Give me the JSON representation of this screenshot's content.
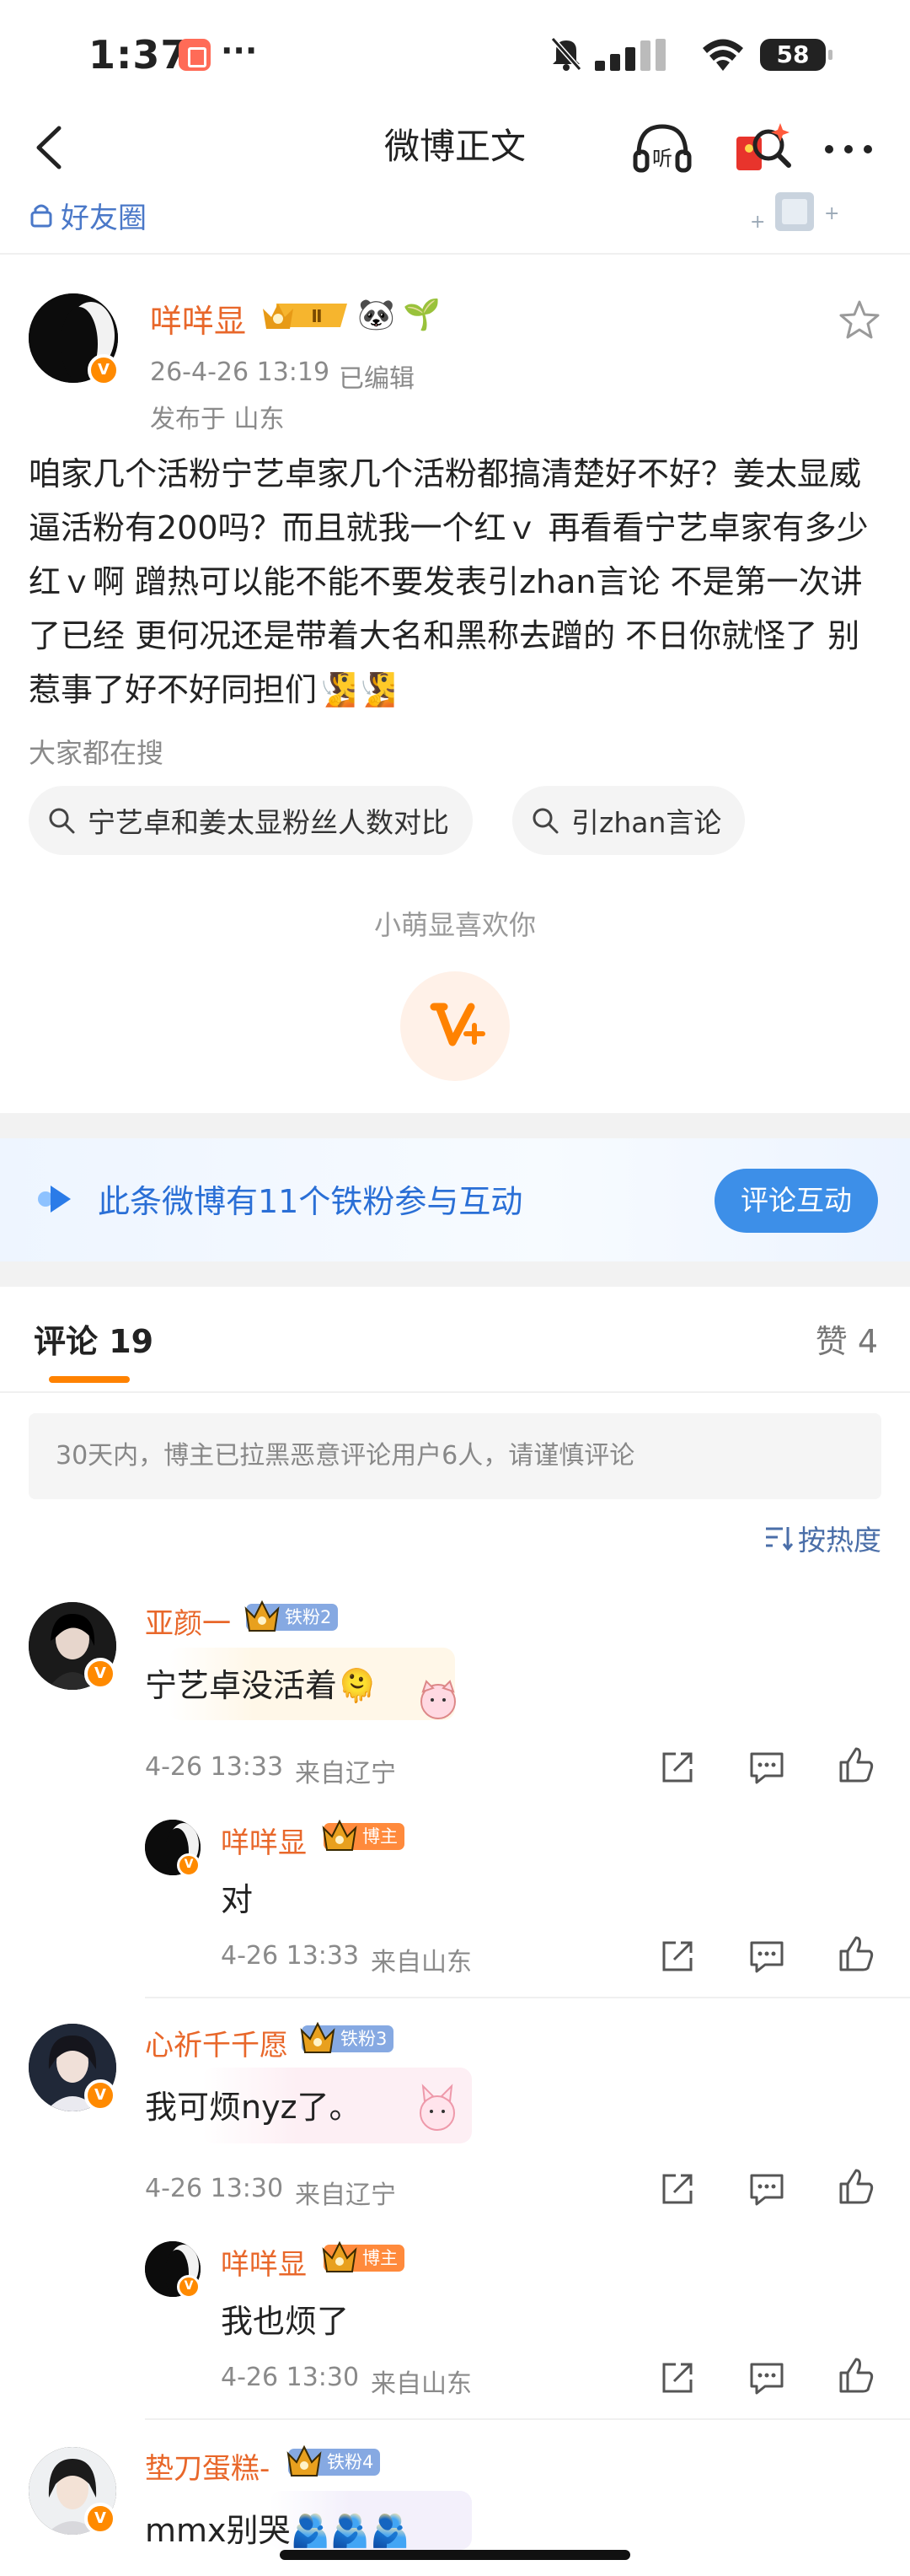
{
  "status_bar": {
    "time": "1:37",
    "dots": "···",
    "battery": "58"
  },
  "nav": {
    "title": "微博正文",
    "listen_label": "听"
  },
  "friends_label": "好友圈",
  "post": {
    "author": "咩咩显",
    "level_badge": "Ⅱ",
    "emoji": [
      "🐼",
      "🌱"
    ],
    "time": "26-4-26 13:19",
    "edited": "已编辑",
    "location": "发布于 山东",
    "text": "咱家几个活粉宁艺卓家几个活粉都搞清楚好不好？姜太显威逼活粉有200吗？而且就我一个红ｖ 再看看宁艺卓家有多少红ｖ啊 蹭热可以能不能不要发表引zhan言论 不是第一次讲了已经 更何况还是带着大名和黑称去蹭的 不日你就怪了 别惹事了好不好同担们🧏🧏",
    "search_label": "大家都在搜",
    "searches": [
      "宁艺卓和姜太显粉丝人数对比",
      "引zhan言论"
    ],
    "like_label": "小萌显喜欢你"
  },
  "fans_banner": {
    "text": "此条微博有11个铁粉参与互动",
    "button": "评论互动"
  },
  "tabs": {
    "comments": "评论 19",
    "likes": "赞 4"
  },
  "notice": "30天内，博主已拉黑恶意评论用户6人，请谨慎评论",
  "sort_label": "按热度",
  "comments": [
    {
      "name": "亚颜一",
      "tag": "铁粉2",
      "text": "宁艺卓没活着🫠",
      "time": "4-26 13:33",
      "from": "来自辽宁",
      "reply": {
        "name": "咩咩显",
        "tag": "博主",
        "text": "对",
        "time": "4-26 13:33",
        "from": "来自山东"
      }
    },
    {
      "name": "心祈千千愿",
      "tag": "铁粉3",
      "text": "我可烦nyz了。",
      "time": "4-26 13:30",
      "from": "来自辽宁",
      "reply": {
        "name": "咩咩显",
        "tag": "博主",
        "text": "我也烦了",
        "time": "4-26 13:30",
        "from": "来自山东"
      }
    },
    {
      "name": "垫刀蛋糕-",
      "tag": "铁粉4",
      "text": "mmx别哭🫂🫂🫂"
    }
  ],
  "colors": {
    "accent": "#ff8200",
    "name": "#e8672a",
    "link": "#2a6fd6"
  }
}
